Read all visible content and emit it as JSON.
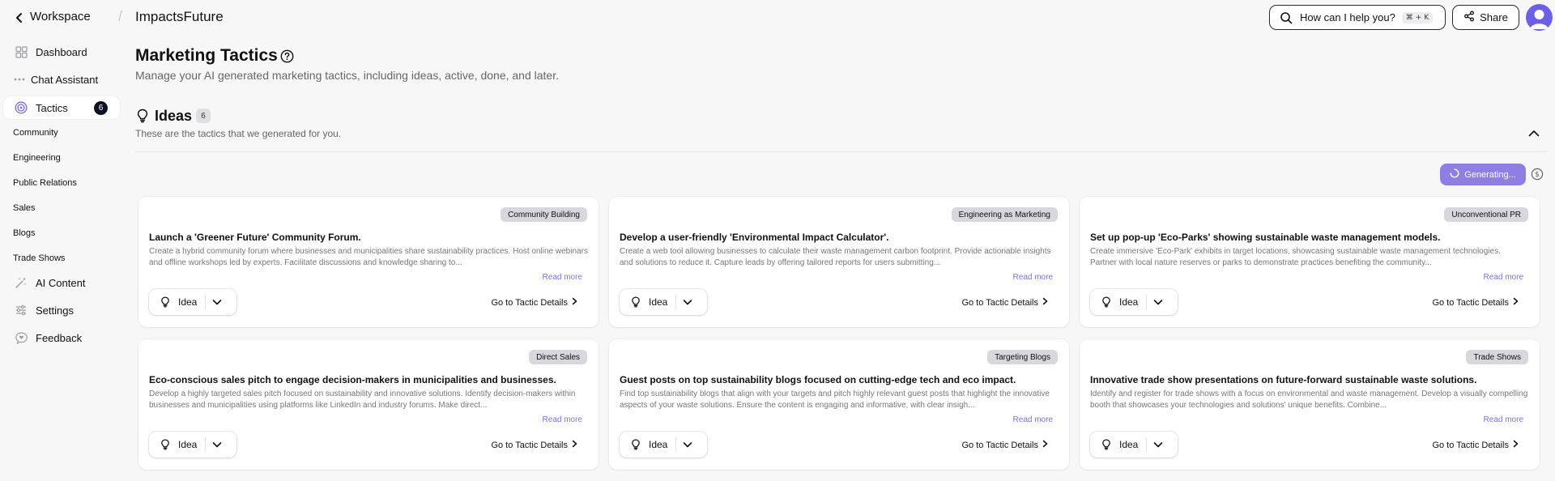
{
  "header": {
    "workspace_label": "Workspace",
    "project_title": "ImpactsFuture",
    "search_label": "How can I help you?",
    "shortcut_keys": [
      "⌘",
      "+",
      "K"
    ],
    "share_label": "Share"
  },
  "sidebar": {
    "items": [
      {
        "label": "Dashboard",
        "icon": "grid-icon"
      },
      {
        "label": "Chat Assistant",
        "icon": "dots-icon"
      },
      {
        "label": "Tactics",
        "icon": "target-icon",
        "badge": "6",
        "active": true
      },
      {
        "label": "AI Content",
        "icon": "wand-icon"
      },
      {
        "label": "Settings",
        "icon": "sliders-icon"
      },
      {
        "label": "Feedback",
        "icon": "chat-bubble-icon"
      }
    ],
    "subitems": [
      "Community",
      "Engineering",
      "Public Relations",
      "Sales",
      "Blogs",
      "Trade Shows"
    ]
  },
  "main": {
    "title": "Marketing Tactics",
    "subtitle": "Manage your AI generated marketing tactics, including ideas, active, done, and later.",
    "section": {
      "title": "Ideas",
      "count": "6",
      "subtitle": "These are the tactics that we generated for you."
    },
    "generating_label": "Generating...",
    "accent_color": "#8f7fe2",
    "cards": [
      {
        "tag": "Community Building",
        "title": "Launch a 'Greener Future' Community Forum.",
        "description": "Create a hybrid community forum where businesses and municipalities share sustainability practices. Host online webinars and offline workshops led by experts. Facilitate discussions and knowledge sharing to...",
        "read_more": "Read more",
        "status": "Idea",
        "details": "Go to Tactic Details"
      },
      {
        "tag": "Engineering as Marketing",
        "title": "Develop a user-friendly 'Environmental Impact Calculator'.",
        "description": "Create a web tool allowing businesses to calculate their waste management carbon footprint. Provide actionable insights and solutions to reduce it. Capture leads by offering tailored reports for users submitting...",
        "read_more": "Read more",
        "status": "Idea",
        "details": "Go to Tactic Details"
      },
      {
        "tag": "Unconventional PR",
        "title": "Set up pop-up 'Eco-Parks' showing sustainable waste management models.",
        "description": "Create immersive 'Eco-Park' exhibits in target locations, showcasing sustainable waste management technologies. Partner with local nature reserves or parks to demonstrate practices benefiting the community...",
        "read_more": "Read more",
        "status": "Idea",
        "details": "Go to Tactic Details"
      },
      {
        "tag": "Direct Sales",
        "title": "Eco-conscious sales pitch to engage decision-makers in municipalities and businesses.",
        "description": "Develop a highly targeted sales pitch focused on sustainability and innovative solutions. Identify decision-makers within businesses and municipalities using platforms like LinkedIn and industry forums. Make direct...",
        "read_more": "Read more",
        "status": "Idea",
        "details": "Go to Tactic Details"
      },
      {
        "tag": "Targeting Blogs",
        "title": "Guest posts on top sustainability blogs focused on cutting-edge tech and eco impact.",
        "description": "Find top sustainability blogs that align with your targets and pitch highly relevant guest posts that highlight the innovative aspects of your waste solutions. Ensure the content is engaging and informative, with clear insigh...",
        "read_more": "Read more",
        "status": "Idea",
        "details": "Go to Tactic Details"
      },
      {
        "tag": "Trade Shows",
        "title": "Innovative trade show presentations on future-forward sustainable waste solutions.",
        "description": "Identify and register for trade shows with a focus on environmental and waste management. Develop a visually compelling booth that showcases your technologies and solutions' unique benefits. Combine...",
        "read_more": "Read more",
        "status": "Idea",
        "details": "Go to Tactic Details"
      }
    ]
  }
}
